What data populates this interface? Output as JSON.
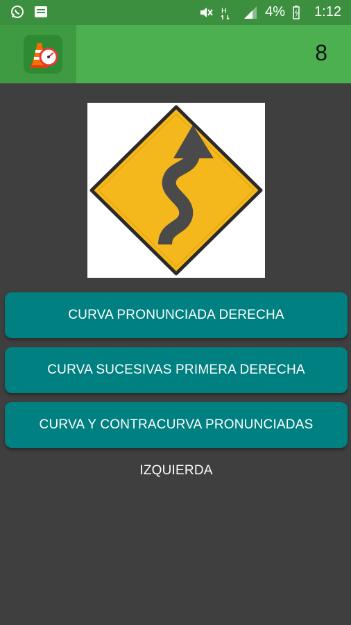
{
  "status_bar": {
    "battery_text": "4%",
    "time": "1:12",
    "icons": [
      "whatsapp-icon",
      "message-icon",
      "mute-icon",
      "network-icon",
      "signal-icon",
      "battery-icon"
    ]
  },
  "app_bar": {
    "logo_icon": "traffic-cone-speedometer-icon",
    "score": "8"
  },
  "question": {
    "sign_icon": "winding-road-sign-icon"
  },
  "answers": [
    {
      "label": "CURVA PRONUNCIADA DERECHA"
    },
    {
      "label": "CURVA SUCESIVAS PRIMERA DERECHA"
    },
    {
      "label": "CURVA Y CONTRACURVA PRONUNCIADAS IZQUIERDA"
    }
  ],
  "colors": {
    "status_bar": "#3b8f3e",
    "app_bar": "#4caf50",
    "background": "#3f3f3f",
    "answer_button": "#008080",
    "sign_yellow": "#f4b71c"
  }
}
